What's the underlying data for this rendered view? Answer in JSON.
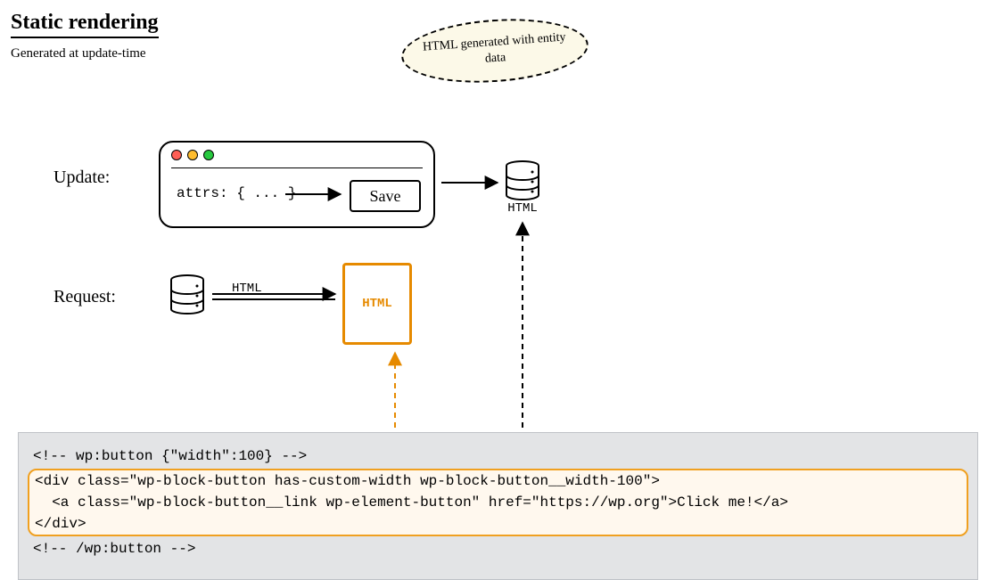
{
  "title": "Static rendering",
  "subtitle": "Generated at update-time",
  "bubble": "HTML generated with entity data",
  "labels": {
    "update": "Update:",
    "request": "Request:"
  },
  "window": {
    "attrs": "attrs: { ... }",
    "save": "Save"
  },
  "db_label": "HTML",
  "html_arrow_label": "HTML",
  "html_box": "HTML",
  "code": {
    "line1": "<!-- wp:button {\"width\":100} -->",
    "line2": "<div class=\"wp-block-button has-custom-width wp-block-button__width-100\">",
    "line3": "  <a class=\"wp-block-button__link wp-element-button\" href=\"https://wp.org\">Click me!</a>",
    "line4": "</div>",
    "line5": "<!-- /wp:button -->"
  }
}
